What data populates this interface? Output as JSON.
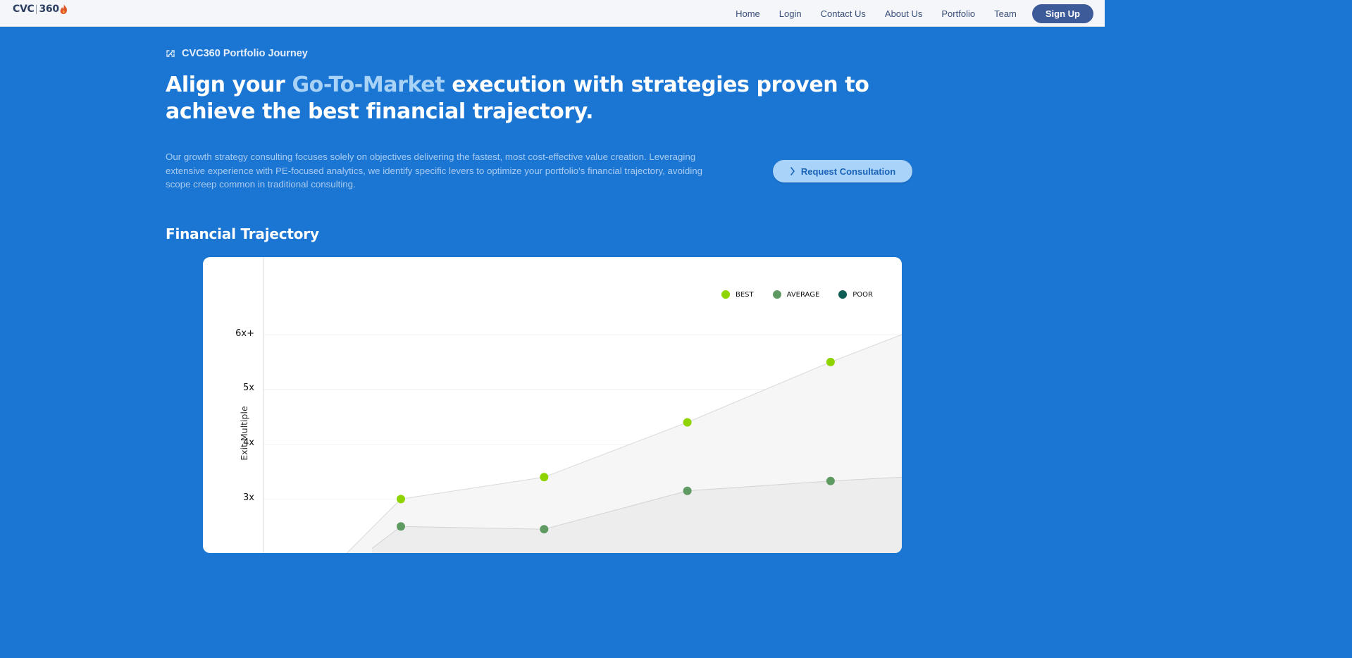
{
  "brand": {
    "logo_left": "CVC",
    "logo_right": "360",
    "accent": "#1b76d3"
  },
  "nav": {
    "items": [
      {
        "label": "Home"
      },
      {
        "label": "Login"
      },
      {
        "label": "Contact Us"
      },
      {
        "label": "About Us"
      },
      {
        "label": "Portfolio"
      },
      {
        "label": "Team"
      }
    ],
    "signup_label": "Sign Up"
  },
  "hero": {
    "eyebrow": "CVC360 Portfolio Journey",
    "headline_pre": "Align your ",
    "headline_highlight": "Go-To-Market",
    "headline_post": " execution with strategies proven to achieve the best financial trajectory.",
    "description": "Our growth strategy consulting focuses solely on objectives delivering the fastest, most cost-effective value creation. Leveraging extensive experience with PE-focused analytics, we identify specific levers to optimize your portfolio's financial trajectory, avoiding scope creep common in traditional consulting.",
    "cta_label": "Request Consultation"
  },
  "section": {
    "title": "Financial Trajectory"
  },
  "chart_data": {
    "type": "scatter",
    "ylabel": "Exit Multiple",
    "yticks": [
      "3x",
      "4x",
      "5x",
      "6x+"
    ],
    "ylim": [
      2.2,
      7.3
    ],
    "grid": true,
    "legend_position": "top-right",
    "series": [
      {
        "name": "BEST",
        "color": "#8fd400",
        "points": [
          [
            1,
            3.0
          ],
          [
            2,
            3.4
          ],
          [
            3,
            4.4
          ],
          [
            4,
            5.5
          ]
        ],
        "trend_end": 6.0
      },
      {
        "name": "AVERAGE",
        "color": "#5f9a63",
        "points": [
          [
            1,
            2.5
          ],
          [
            2,
            2.45
          ],
          [
            3,
            3.15
          ],
          [
            4,
            3.33
          ]
        ],
        "trend_end": 3.4
      },
      {
        "name": "POOR",
        "color": "#0e5e56",
        "points": []
      }
    ]
  }
}
